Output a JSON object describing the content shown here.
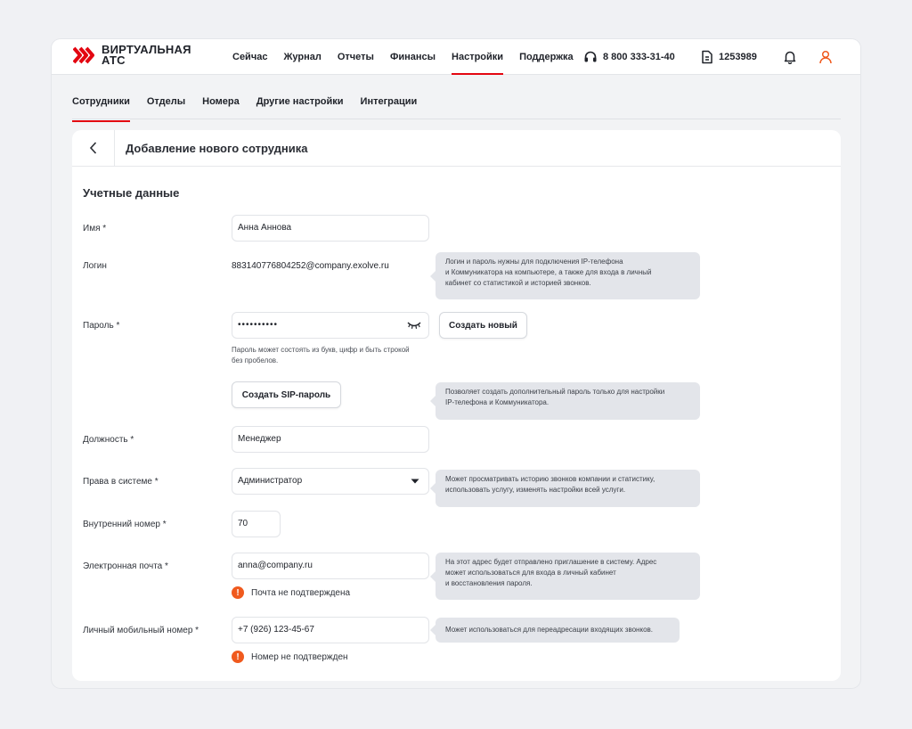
{
  "brand": {
    "line1": "ВИРТУАЛЬНАЯ",
    "line2": "АТС",
    "color": "#e30611"
  },
  "nav": {
    "items": [
      {
        "label": "Сейчас"
      },
      {
        "label": "Журнал"
      },
      {
        "label": "Отчеты"
      },
      {
        "label": "Финансы"
      },
      {
        "label": "Настройки",
        "active": true
      },
      {
        "label": "Поддержка"
      }
    ],
    "phone": "8 800 333-31-40",
    "account": "1253989",
    "icons": [
      "headset-icon",
      "document-icon",
      "bell-icon",
      "user-icon"
    ]
  },
  "subnav": {
    "items": [
      {
        "label": "Сотрудники",
        "active": true
      },
      {
        "label": "Отделы"
      },
      {
        "label": "Номера"
      },
      {
        "label": "Другие настройки"
      },
      {
        "label": "Интеграции"
      }
    ]
  },
  "page": {
    "title": "Добавление нового сотрудника",
    "section": "Учетные данные"
  },
  "form": {
    "name": {
      "label": "Имя *",
      "value": "Анна Аннова"
    },
    "login": {
      "label": "Логин",
      "value": "883140776804252@company.exolve.ru",
      "tip": [
        "Логин и пароль нужны для подключения IP-телефона",
        "и Коммуникатора на компьютере, а также для входа в личный",
        "кабинет со статистикой и историей звонков."
      ]
    },
    "password": {
      "label": "Пароль *",
      "value": "••••••••••",
      "new_button": "Создать новый",
      "hint": [
        "Пароль может состоять из букв, цифр и быть строкой",
        "без пробелов."
      ]
    },
    "sip": {
      "button": "Создать SIP-пароль",
      "tip": [
        "Позволяет создать дополнительный пароль только для настройки",
        "IP-телефона и Коммуникатора."
      ]
    },
    "position": {
      "label": "Должность *",
      "value": "Менеджер"
    },
    "rights": {
      "label": "Права в системе *",
      "value": "Администратор",
      "tip": [
        "Может просматривать историю звонков компании и статистику,",
        "использовать услугу, изменять настройки всей услуги."
      ]
    },
    "extension": {
      "label": "Внутренний номер *",
      "value": "70"
    },
    "email": {
      "label": "Электронная почта *",
      "value": "anna@company.ru",
      "warning": "Почта не подтверждена",
      "tip": [
        "На этот адрес будет отправлено приглашение в систему. Адрес",
        "может использоваться для входа в личный кабинет",
        "и восстановления пароля."
      ]
    },
    "mobile": {
      "label": "Личный мобильный номер *",
      "value": "+7 (926) 123-45-67",
      "warning": "Номер не подтвержден",
      "tip": [
        "Может использоваться для переадресации входящих звонков."
      ]
    }
  }
}
